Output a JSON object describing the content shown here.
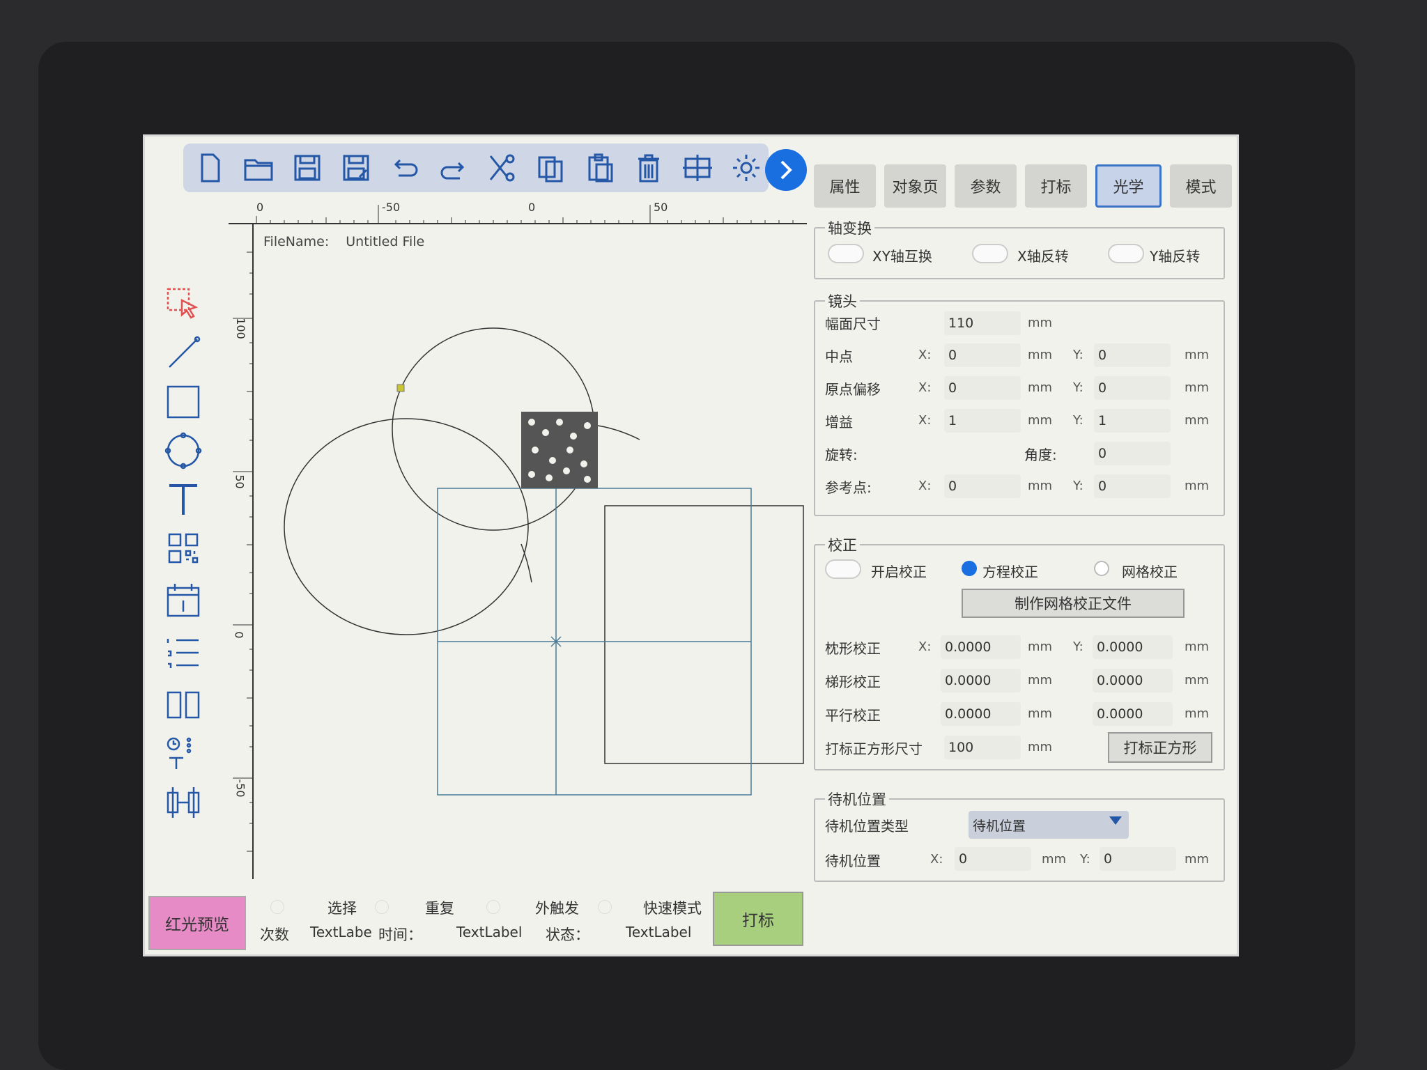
{
  "tabs": [
    {
      "label": "属性"
    },
    {
      "label": "对象页"
    },
    {
      "label": "参数"
    },
    {
      "label": "打标"
    },
    {
      "label": "光学",
      "active": true
    },
    {
      "label": "模式"
    }
  ],
  "toolbar_icons": [
    "new-file-icon",
    "open-folder-icon",
    "save-icon",
    "save-as-icon",
    "undo-icon",
    "redo-icon",
    "cut-icon",
    "copy-icon",
    "paste-icon",
    "delete-icon",
    "grid-icon",
    "settings-icon"
  ],
  "ruler": {
    "h_labels": [
      "0",
      "-50",
      "0",
      "50"
    ],
    "v_labels": [
      "100",
      "50",
      "0",
      "-50"
    ]
  },
  "file": {
    "label": "FileName:",
    "value": "Untitled  File"
  },
  "axis_transform": {
    "title": "轴变换",
    "xy_swap": "XY轴互换",
    "x_flip": "X轴反转",
    "y_flip": "Y轴反转"
  },
  "lens": {
    "title": "镜头",
    "field_size_label": "幅面尺寸",
    "field_size": "110",
    "center_label": "中点",
    "origin_offset_label": "原点偏移",
    "gain_label": "增益",
    "rotation_label": "旋转:",
    "angle_label": "角度:",
    "ref_point_label": "参考点:",
    "x": "X:",
    "y": "Y:",
    "unit": "mm",
    "center_x": "0",
    "center_y": "0",
    "offset_x": "0",
    "offset_y": "0",
    "gain_x": "1",
    "gain_y": "1",
    "angle": "0",
    "ref_x": "0",
    "ref_y": "0"
  },
  "correction": {
    "title": "校正",
    "enable_label": "开启校正",
    "equation_label": "方程校正",
    "grid_label": "网格校正",
    "make_grid_btn": "制作网格校正文件",
    "pillow_label": "枕形校正",
    "trapezoid_label": "梯形校正",
    "parallel_label": "平行校正",
    "square_size_label": "打标正方形尺寸",
    "square_size": "100",
    "mark_square_btn": "打标正方形",
    "pillow_x": "0.0000",
    "pillow_y": "0.0000",
    "trap_x": "0.0000",
    "trap_y": "0.0000",
    "para_x": "0.0000",
    "para_y": "0.0000",
    "x": "X:",
    "y": "Y:",
    "unit": "mm"
  },
  "standby": {
    "title": "待机位置",
    "type_label": "待机位置类型",
    "type_value": "待机位置",
    "pos_label": "待机位置",
    "x": "X:",
    "x_val": "0",
    "y": "Y:",
    "y_val": "0",
    "unit": "mm"
  },
  "bottom": {
    "red_preview": "红光预览",
    "select": "选择",
    "repeat": "重复",
    "ext_trigger": "外触发",
    "fast_mode": "快速模式",
    "count_label": "次数",
    "count_value": "TextLabe",
    "time_label": "时间：",
    "time_value": "TextLabel",
    "status_label": "状态：",
    "status_value": "TextLabel",
    "mark": "打标"
  }
}
